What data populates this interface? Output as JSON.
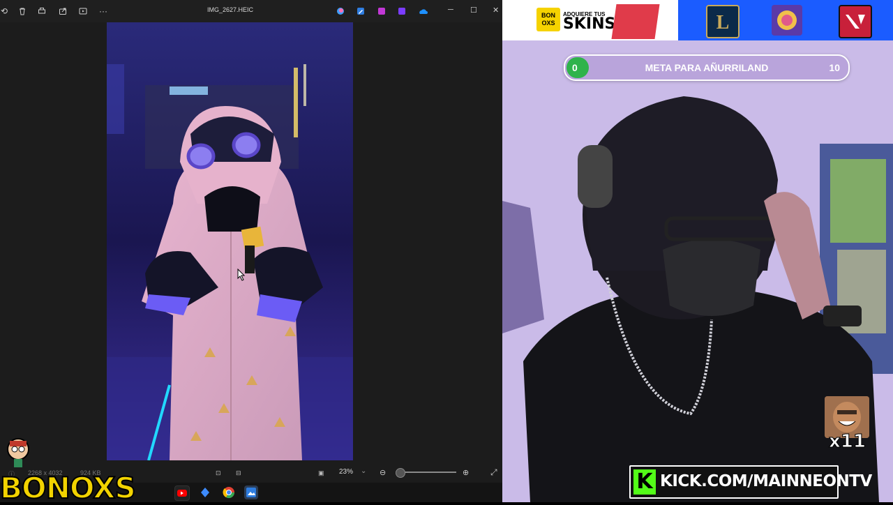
{
  "viewer": {
    "title": "IMG_2627.HEIC",
    "more_label": "···",
    "dimensions": "2268 x 4032",
    "file_size": "924 KB",
    "zoom": "23%"
  },
  "overlay": {
    "logo_text": "BONOXS"
  },
  "stream": {
    "sponsor": {
      "badge": "BON OXS",
      "tagline": "ADQUIERE TUS",
      "headline": "SKINS"
    },
    "goal": {
      "start": "0",
      "title": "META PARA AÑURRILAND",
      "end": "10"
    },
    "emote_count": "x11",
    "kick_url": "KICK.COM/MAINNEONTV",
    "kick_letter": "K"
  }
}
